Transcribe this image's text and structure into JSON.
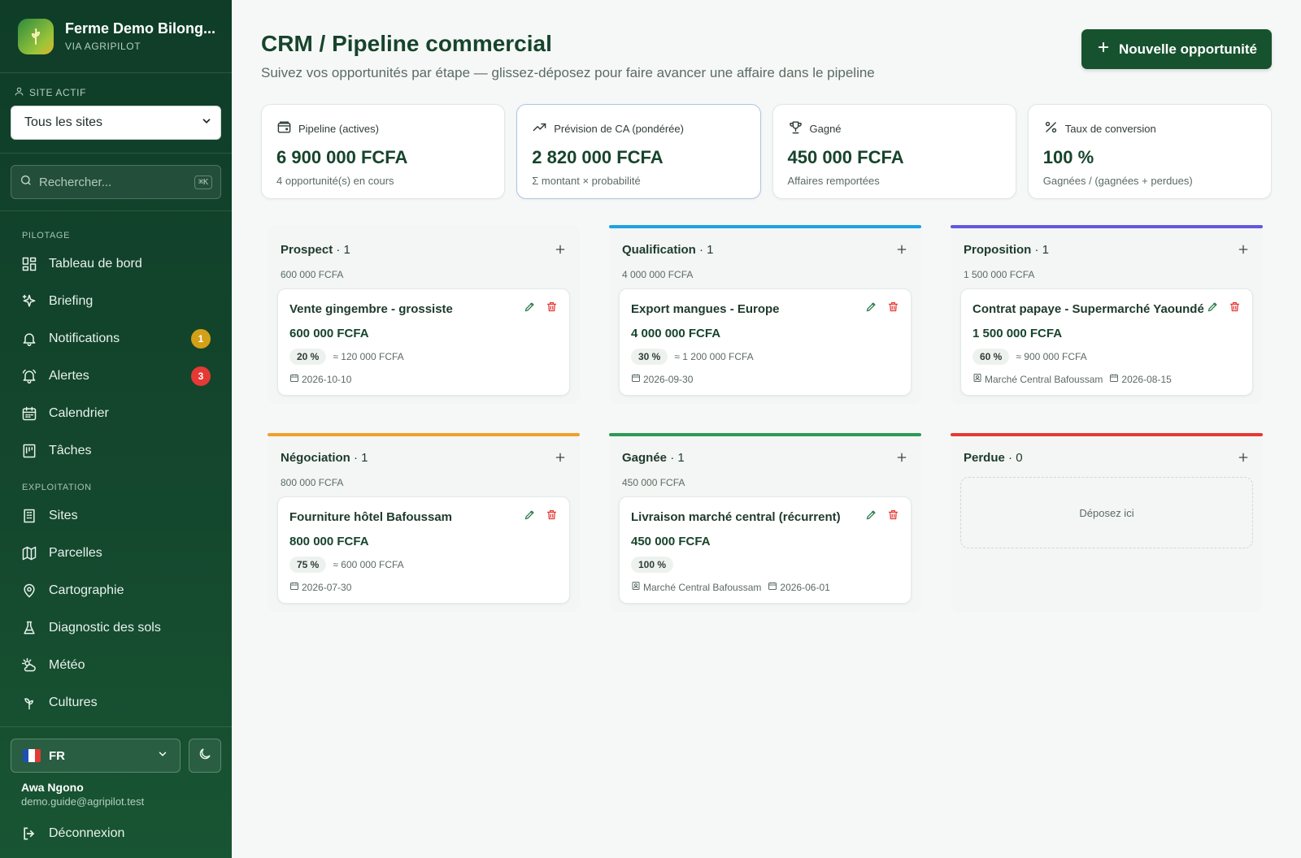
{
  "brand": {
    "name": "Ferme Demo Bilong...",
    "sub": "VIA AGRIPILOT"
  },
  "site": {
    "label": "SITE ACTIF",
    "value": "Tous les sites"
  },
  "search": {
    "placeholder": "Rechercher...",
    "shortcut": "⌘K"
  },
  "nav": {
    "section1": "PILOTAGE",
    "items1": [
      {
        "label": "Tableau de bord",
        "icon": "dashboard-icon"
      },
      {
        "label": "Briefing",
        "icon": "sparkle-icon"
      },
      {
        "label": "Notifications",
        "icon": "bell-icon",
        "badge": "1",
        "badge_color": "#d4a017"
      },
      {
        "label": "Alertes",
        "icon": "bell-ring-icon",
        "badge": "3",
        "badge_color": "#e53935"
      },
      {
        "label": "Calendrier",
        "icon": "calendar-icon"
      },
      {
        "label": "Tâches",
        "icon": "tasks-icon"
      }
    ],
    "section2": "EXPLOITATION",
    "items2": [
      {
        "label": "Sites",
        "icon": "building-icon"
      },
      {
        "label": "Parcelles",
        "icon": "map-icon"
      },
      {
        "label": "Cartographie",
        "icon": "map-pin-icon"
      },
      {
        "label": "Diagnostic des sols",
        "icon": "flask-icon"
      },
      {
        "label": "Météo",
        "icon": "weather-icon"
      },
      {
        "label": "Cultures",
        "icon": "sprout-icon"
      }
    ]
  },
  "footer": {
    "lang": "FR",
    "user_name": "Awa Ngono",
    "user_email": "demo.guide@agripilot.test",
    "logout": "Déconnexion"
  },
  "header": {
    "title": "CRM / Pipeline commercial",
    "subtitle": "Suivez vos opportunités par étape — glissez-déposez pour faire avancer une affaire dans le pipeline",
    "new_button": "Nouvelle opportunité"
  },
  "kpis": [
    {
      "label": "Pipeline (actives)",
      "value": "6 900 000 FCFA",
      "note": "4 opportunité(s) en cours",
      "icon": "wallet-icon"
    },
    {
      "label": "Prévision de CA (pondérée)",
      "value": "2 820 000 FCFA",
      "note": "Σ montant × probabilité",
      "icon": "trend-up-icon"
    },
    {
      "label": "Gagné",
      "value": "450 000 FCFA",
      "note": "Affaires remportées",
      "icon": "trophy-icon"
    },
    {
      "label": "Taux de conversion",
      "value": "100 %",
      "note": "Gagnées / (gagnées + perdues)",
      "icon": "percent-icon"
    }
  ],
  "columns": [
    {
      "title": "Prospect",
      "count": "· 1",
      "total": "600 000 FCFA",
      "color": "",
      "cards": [
        {
          "title": "Vente gingembre - grossiste",
          "amount": "600 000 FCFA",
          "prob": "20 %",
          "weighted": "≈ 120 000 FCFA",
          "location": "",
          "date": "2026-10-10"
        }
      ]
    },
    {
      "title": "Qualification",
      "count": "· 1",
      "total": "4 000 000 FCFA",
      "color": "#1fa2e0",
      "cards": [
        {
          "title": "Export mangues - Europe",
          "amount": "4 000 000 FCFA",
          "prob": "30 %",
          "weighted": "≈ 1 200 000 FCFA",
          "location": "",
          "date": "2026-09-30"
        }
      ]
    },
    {
      "title": "Proposition",
      "count": "· 1",
      "total": "1 500 000 FCFA",
      "color": "#6358dc",
      "cards": [
        {
          "title": "Contrat papaye - Supermarché Yaoundé",
          "amount": "1 500 000 FCFA",
          "prob": "60 %",
          "weighted": "≈ 900 000 FCFA",
          "location": "Marché Central Bafoussam",
          "date": "2026-08-15"
        }
      ]
    },
    {
      "title": "Négociation",
      "count": "· 1",
      "total": "800 000 FCFA",
      "color": "#f0a030",
      "cards": [
        {
          "title": "Fourniture hôtel Bafoussam",
          "amount": "800 000 FCFA",
          "prob": "75 %",
          "weighted": "≈ 600 000 FCFA",
          "location": "",
          "date": "2026-07-30"
        }
      ]
    },
    {
      "title": "Gagnée",
      "count": "· 1",
      "total": "450 000 FCFA",
      "color": "#2e9a55",
      "cards": [
        {
          "title": "Livraison marché central (récurrent)",
          "amount": "450 000 FCFA",
          "prob": "100 %",
          "weighted": "",
          "location": "Marché Central Bafoussam",
          "date": "2026-06-01"
        }
      ]
    },
    {
      "title": "Perdue",
      "count": "· 0",
      "total": "",
      "color": "#e53935",
      "cards": [],
      "drop_text": "Déposez ici"
    }
  ]
}
